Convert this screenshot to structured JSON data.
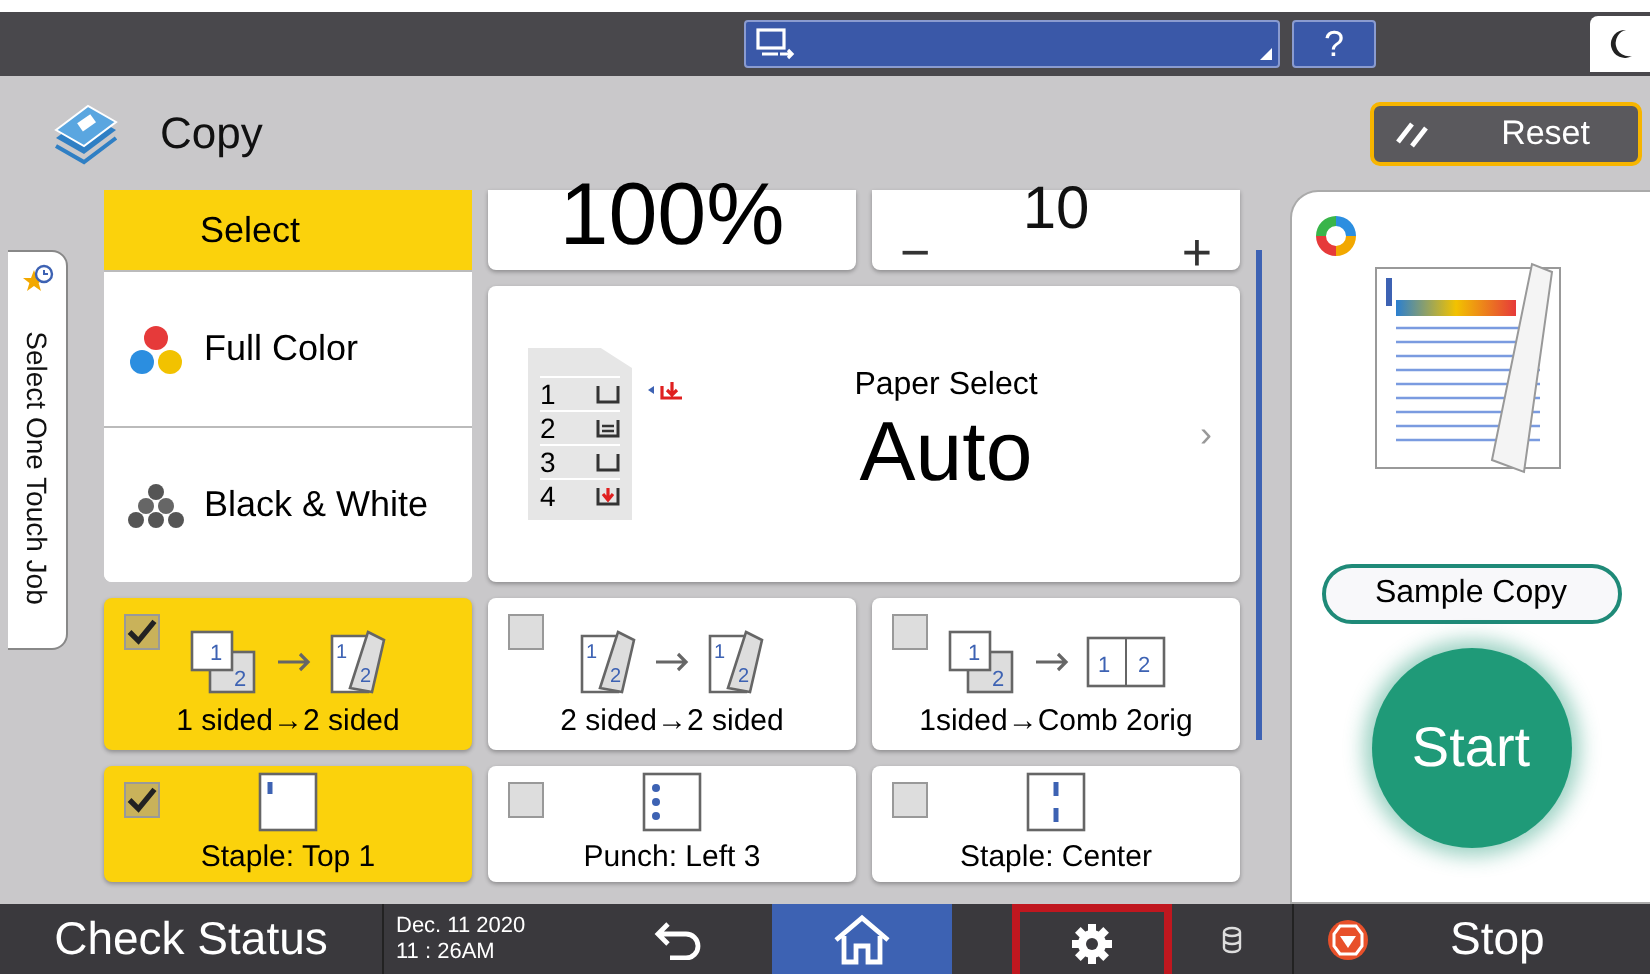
{
  "top_bar": {
    "help_button": "?"
  },
  "header": {
    "title": "Copy",
    "reset_button": "Reset"
  },
  "side_tab": "Select One Touch Job",
  "color_modes": [
    {
      "label": "Select",
      "selected": true
    },
    {
      "label": "Full Color",
      "selected": false
    },
    {
      "label": "Black & White",
      "selected": false
    }
  ],
  "reduce_enlarge": "100%",
  "quantity": {
    "value": "10",
    "decrement": "−",
    "increment": "+"
  },
  "paper_select": {
    "label": "Paper Select",
    "value": "Auto",
    "chevron": "›",
    "trays": [
      {
        "number": "1",
        "kind": "empty"
      },
      {
        "number": "2",
        "kind": "loaded"
      },
      {
        "number": "3",
        "kind": "empty"
      },
      {
        "number": "4",
        "kind": "alert"
      }
    ]
  },
  "duplex_options": [
    {
      "label": "1 sided→2 sided",
      "kind": "one-to-two",
      "source_pages": [
        "1",
        "2"
      ],
      "target_pages": [
        "1",
        "2"
      ],
      "checked": true,
      "selected": true
    },
    {
      "label": "2 sided→2 sided",
      "kind": "two-to-two",
      "source_pages": [
        "1",
        "2"
      ],
      "target_pages": [
        "1",
        "2"
      ],
      "checked": false,
      "selected": false
    },
    {
      "label": "1sided→Comb 2orig",
      "kind": "one-to-combine",
      "source_pages": [
        "1",
        "2"
      ],
      "target_pages": [
        "1",
        "2"
      ],
      "checked": false,
      "selected": false
    }
  ],
  "finishing_options": [
    {
      "label": "Staple: Top 1",
      "kind": "staple-top",
      "checked": true,
      "selected": true
    },
    {
      "label": "Punch: Left 3",
      "kind": "punch-left",
      "checked": false,
      "selected": false
    },
    {
      "label": "Staple: Center",
      "kind": "staple-center",
      "checked": false,
      "selected": false
    }
  ],
  "right_panel": {
    "sample_copy_button": "Sample Copy",
    "start_button": "Start"
  },
  "bottom_bar": {
    "check_status": "Check Status",
    "date": "Dec. 11 2020",
    "time": "11 : 26AM",
    "settings_highlighted": true,
    "stop_button": "Stop"
  }
}
